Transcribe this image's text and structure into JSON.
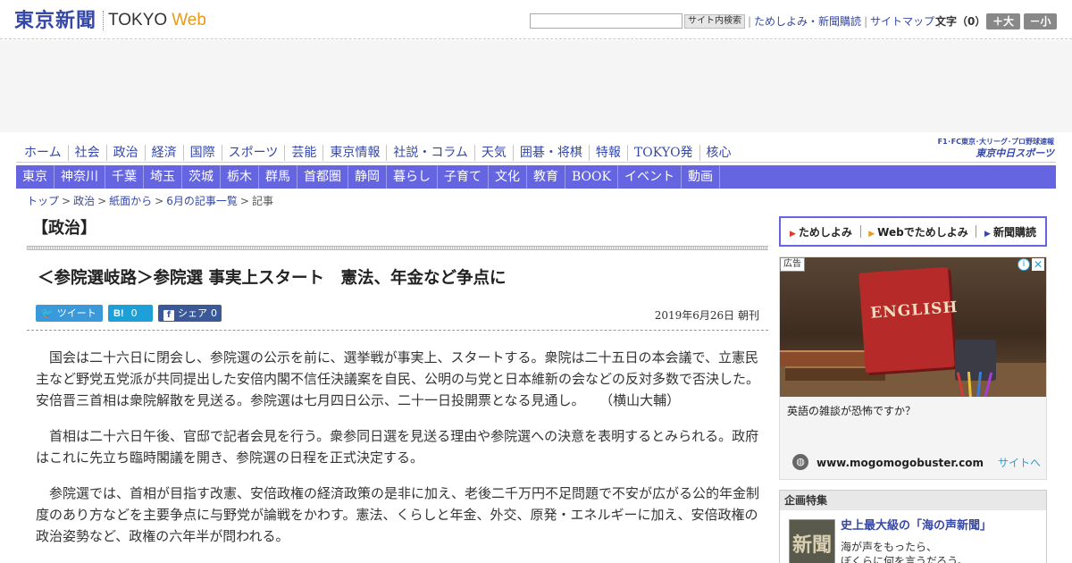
{
  "header": {
    "logo_jp": "東京新聞",
    "logo_en": "TOKYO",
    "logo_web": "Web",
    "search_button": "サイト内検索",
    "links": [
      "ためしよみ・新聞購読",
      "サイトマップ"
    ],
    "font_size_label": "文字（0）",
    "font_plus": "＋大",
    "font_minus": "－小"
  },
  "global_nav": [
    "ホーム",
    "社会",
    "政治",
    "経済",
    "国際",
    "スポーツ",
    "芸能",
    "東京情報",
    "社説・コラム",
    "天気",
    "囲碁・将棋",
    "特報",
    "TOKYO発",
    "核心"
  ],
  "brand_sports": {
    "line1": "F1･FC東京･大リーグ･プロ野球速報",
    "line2": "東京中日スポーツ"
  },
  "regional_nav": [
    "東京",
    "神奈川",
    "千葉",
    "埼玉",
    "茨城",
    "栃木",
    "群馬",
    "首都圏",
    "静岡",
    "暮らし",
    "子育て",
    "文化",
    "教育",
    "BOOK",
    "イベント",
    "動画"
  ],
  "breadcrumb": [
    "トップ",
    "政治",
    "紙面から",
    "6月の記事一覧",
    "記事"
  ],
  "article": {
    "section": "【政治】",
    "headline": "＜参院選岐路＞参院選 事実上スタート　憲法、年金など争点に",
    "share": {
      "tweet_label": "ツイート",
      "hatena_icon": "B!",
      "hatena_count": "0",
      "fb_icon": "f",
      "fb_label": "シェア",
      "fb_count": "0"
    },
    "date": "2019年6月26日 朝刊",
    "paragraphs": [
      "国会は二十六日に閉会し、参院選の公示を前に、選挙戦が事実上、スタートする。衆院は二十五日の本会議で、立憲民主など野党五党派が共同提出した安倍内閣不信任決議案を自民、公明の与党と日本維新の会などの反対多数で否決した。安倍晋三首相は衆院解散を見送る。参院選は七月四日公示、二十一日投開票となる見通し。",
      "首相は二十六日午後、官邸で記者会見を行う。衆参同日選を見送る理由や参院選への決意を表明するとみられる。政府はこれに先立ち臨時閣議を開き、参院選の日程を正式決定する。",
      "参院選では、首相が目指す改憲、安倍政権の経済政策の是非に加え、老後二千万円不足問題で不安が広がる公的年金制度のあり方などを主要争点に与野党が論戦をかわす。憲法、くらしと年金、外交、原発・エネルギーに加え、安倍政権の政治姿勢など、政権の六年半が問われる。"
    ],
    "author": "（横山大輔）"
  },
  "sidebar": {
    "tabs": [
      "ためしよみ",
      "Webでためしよみ",
      "新聞購読"
    ],
    "ad": {
      "label": "広告",
      "info": "i",
      "close": "✕",
      "book_title": "ENGLISH",
      "caption": "英語の雑談が恐怖ですか？",
      "domain": "www.mogomogobuster.com",
      "cta": "サイトへ"
    },
    "feature": {
      "heading": "企画特集",
      "thumb_text": "新聞",
      "title": "史上最大級の「海の声新聞」",
      "sub1": "海が声をもったら、",
      "sub2": "ぼくらに何を言うだろう。"
    }
  },
  "colors": {
    "brand_blue": "#3548a8",
    "nav_purple": "#6565e2",
    "web_orange": "#e89a1a",
    "twitter": "#3a9ad9",
    "hatena": "#1d9fd8",
    "facebook": "#3b5998"
  }
}
